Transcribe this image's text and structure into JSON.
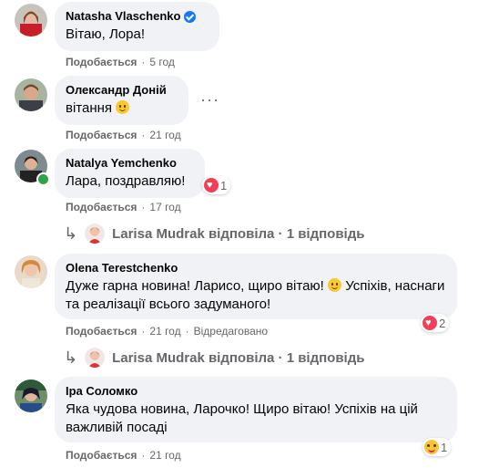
{
  "comments": [
    {
      "author": "Natasha Vlaschenko",
      "verified": true,
      "text": "Вітаю, Лора!",
      "like": "Подобається",
      "time": "5 год"
    },
    {
      "author": "Олександр Доній",
      "text_before": "вітання",
      "text_emoji": "smiley-icon",
      "like": "Подобається",
      "time": "21 год"
    },
    {
      "author": "Natalya Yemchenko",
      "text": "Лара, поздравляю!",
      "like": "Подобається",
      "time": "17 год",
      "reaction_count": "1"
    },
    {
      "author": "Olena Terestchenko",
      "text_before": "Дуже гарна новина! Ларисо, щиро вітаю!",
      "text_after": "Успіхів, наснаги та реалізації всього задуманого!",
      "like": "Подобається",
      "time": "21 год",
      "edited": "Відредаговано",
      "reaction_count": "2"
    },
    {
      "author": "Іра Соломко",
      "text": "Яка чудова новина, Ларочко! Щиро вітаю! Успіхів на цій важливій посаді",
      "like": "Подобається",
      "time": "21 год",
      "reaction_count": "1"
    }
  ],
  "replies": [
    {
      "text": "Larisa Mudrak відповіла · 1 відповідь"
    },
    {
      "text": "Larisa Mudrak відповіла · 1 відповідь"
    }
  ],
  "separator": "·",
  "colors": {
    "bubble": "#f0f2f5",
    "meta": "#65676b",
    "verified": "#1877f2",
    "heart": "#f33e58",
    "online": "#31a24c"
  }
}
